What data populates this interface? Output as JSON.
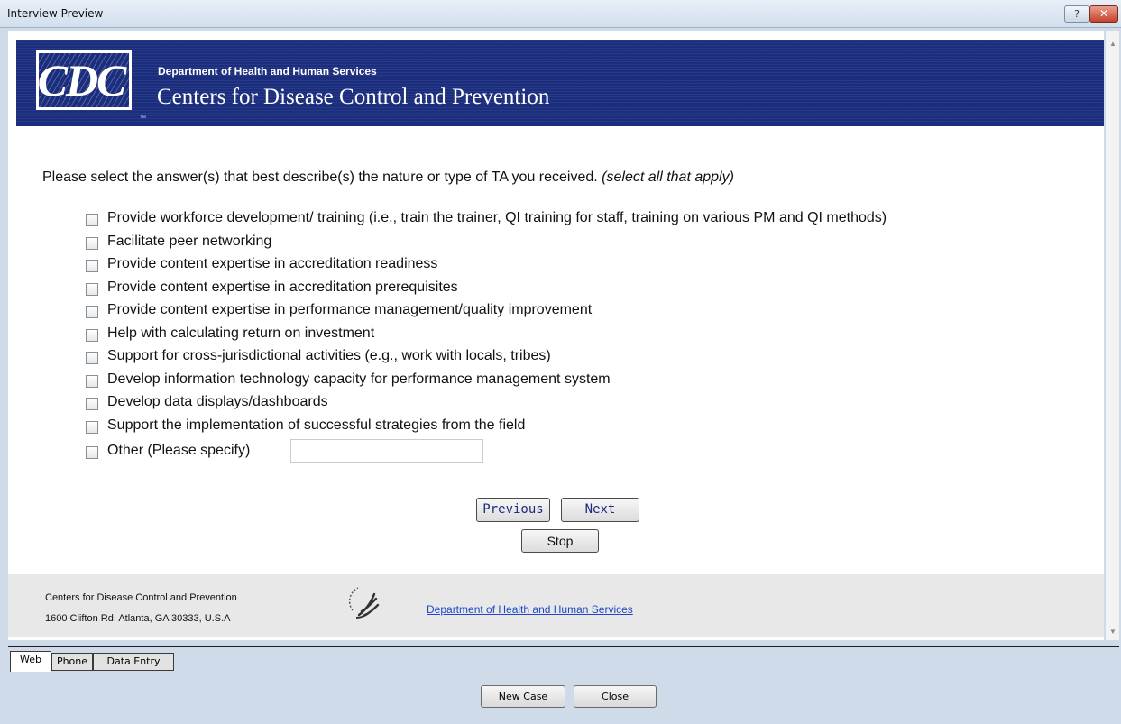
{
  "window": {
    "title": "Interview Preview",
    "help_label": "?",
    "close_label": "✕"
  },
  "header": {
    "logo_text": "CDC",
    "dept_small": "Department of Health and Human Services",
    "dept_big": "Centers for Disease Control and Prevention"
  },
  "question": {
    "text": "Please select the answer(s) that best describe(s) the nature or type of TA you received.",
    "hint": "(select all that apply)"
  },
  "options": [
    "Provide workforce development/ training (i.e., train the trainer, QI training for staff, training on various PM and QI methods)",
    "Facilitate peer networking",
    "Provide content expertise in accreditation readiness",
    "Provide content expertise in accreditation prerequisites",
    "Provide content expertise in performance management/quality improvement",
    "Help with calculating return on investment",
    "Support for cross-jurisdictional activities (e.g., work with locals, tribes)",
    "Develop information technology capacity for performance management system",
    "Develop data displays/dashboards",
    "Support the implementation of successful strategies from the field",
    "Other (Please specify)"
  ],
  "other_input": {
    "value": ""
  },
  "buttons": {
    "previous": "Previous",
    "next": "Next",
    "stop": "Stop"
  },
  "footer": {
    "org": "Centers for Disease Control and Prevention",
    "address": "1600 Clifton Rd, Atlanta, GA 30333, U.S.A",
    "link": "Department of Health and Human Services"
  },
  "tabs": [
    {
      "label": "Web",
      "active": true
    },
    {
      "label": "Phone",
      "active": false
    },
    {
      "label": "Data Entry",
      "active": false
    }
  ],
  "actions": {
    "new_case": "New Case",
    "close": "Close"
  }
}
